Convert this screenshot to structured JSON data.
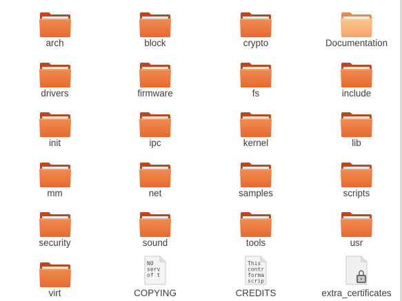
{
  "colors": {
    "folder_back": "#c2461b",
    "folder_front": "#e8692e",
    "folder_front_top": "#f08c52",
    "folder_front_light": "#f7a467",
    "folder_paper": "#f2f2f0",
    "label_text": "#3c3c3c"
  },
  "items": [
    {
      "label": "arch",
      "icon": "folder-icon"
    },
    {
      "label": "block",
      "icon": "folder-icon"
    },
    {
      "label": "crypto",
      "icon": "folder-icon"
    },
    {
      "label": "Documentation",
      "icon": "folder-icon-light"
    },
    {
      "label": "drivers",
      "icon": "folder-icon"
    },
    {
      "label": "firmware",
      "icon": "folder-icon"
    },
    {
      "label": "fs",
      "icon": "folder-icon"
    },
    {
      "label": "include",
      "icon": "folder-icon"
    },
    {
      "label": "init",
      "icon": "folder-icon"
    },
    {
      "label": "ipc",
      "icon": "folder-icon"
    },
    {
      "label": "kernel",
      "icon": "folder-icon"
    },
    {
      "label": "lib",
      "icon": "folder-icon"
    },
    {
      "label": "mm",
      "icon": "folder-icon"
    },
    {
      "label": "net",
      "icon": "folder-icon"
    },
    {
      "label": "samples",
      "icon": "folder-icon"
    },
    {
      "label": "scripts",
      "icon": "folder-icon"
    },
    {
      "label": "security",
      "icon": "folder-icon"
    },
    {
      "label": "sound",
      "icon": "folder-icon"
    },
    {
      "label": "tools",
      "icon": "folder-icon"
    },
    {
      "label": "usr",
      "icon": "folder-icon"
    },
    {
      "label": "virt",
      "icon": "folder-icon"
    },
    {
      "label": "COPYING",
      "icon": "text-file-icon",
      "preview": [
        "NO",
        "serv",
        "of t"
      ]
    },
    {
      "label": "CREDITS",
      "icon": "text-file-icon",
      "preview": [
        "This",
        "contr",
        "forma",
        "scrip"
      ]
    },
    {
      "label": "extra_certificates",
      "icon": "locked-file-icon"
    }
  ]
}
